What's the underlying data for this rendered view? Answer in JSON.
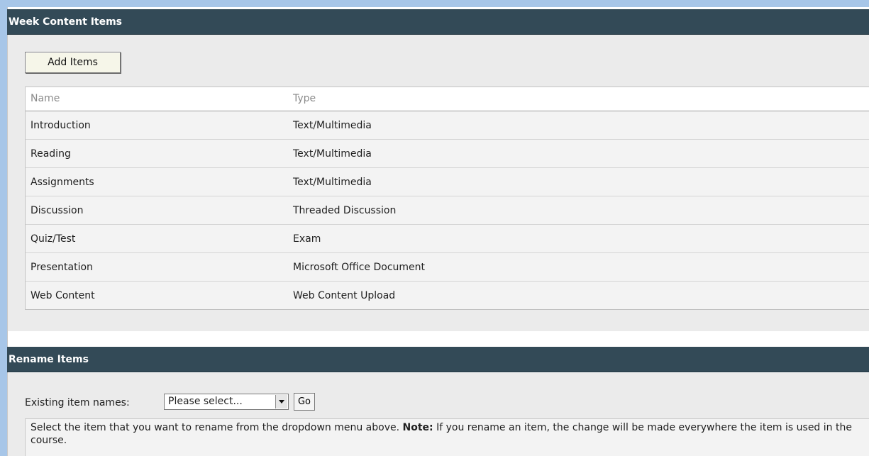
{
  "sections": {
    "week_content": {
      "title": "Week Content Items",
      "add_button_label": "Add Items",
      "table": {
        "headers": {
          "name": "Name",
          "type": "Type"
        },
        "rows": [
          {
            "name": "Introduction",
            "type": "Text/Multimedia"
          },
          {
            "name": "Reading",
            "type": "Text/Multimedia"
          },
          {
            "name": "Assignments",
            "type": "Text/Multimedia"
          },
          {
            "name": "Discussion",
            "type": "Threaded Discussion"
          },
          {
            "name": "Quiz/Test",
            "type": "Exam"
          },
          {
            "name": "Presentation",
            "type": "Microsoft Office Document"
          },
          {
            "name": "Web Content",
            "type": "Web Content Upload"
          }
        ]
      }
    },
    "rename_items": {
      "title": "Rename Items",
      "existing_label": "Existing item names:",
      "select_value": "Please select...",
      "go_label": "Go",
      "note_intro": "Select the item that you want to rename from the dropdown menu above.",
      "note_strong": "Note:",
      "note_rest": "If you rename an item, the change will be made everywhere the item is used in the course."
    }
  },
  "colors": {
    "header_bg": "#334a57",
    "panel_bg": "#ebebeb",
    "frame_accent": "#a7c6e8"
  }
}
